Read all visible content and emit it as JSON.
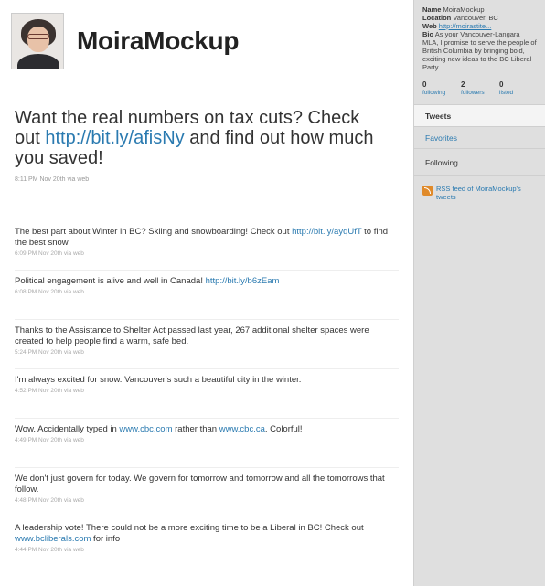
{
  "profile": {
    "screen_name": "MoiraMockup",
    "avatar_icon": "person-photo"
  },
  "featured_tweet": {
    "text_before": "Want the real numbers on tax cuts? Check out ",
    "link": "http://bit.ly/afisNy",
    "text_after": " and find out how much you saved!",
    "meta": "8:11 PM Nov 20th via web"
  },
  "tweets": [
    {
      "text": "The best part about Winter in BC? Skiing and snowboarding! Check out ",
      "link": "http://bit.ly/ayqUfT",
      "after": " to find the best snow.",
      "meta": "6:09 PM Nov 20th via web"
    },
    {
      "text": "Political engagement is alive and well in Canada! ",
      "link": "http://bit.ly/b6zEam",
      "after": "",
      "meta": "6:08 PM Nov 20th via web"
    },
    {
      "text": "Thanks to the Assistance to Shelter Act passed last year, 267 additional shelter spaces were created to help people find a warm, safe bed.",
      "link": "",
      "after": "",
      "meta": "5:24 PM Nov 20th via web"
    },
    {
      "text": "I'm always excited for snow. Vancouver's such a beautiful city in the winter.",
      "link": "",
      "after": "",
      "meta": "4:52 PM Nov 20th via web"
    },
    {
      "text": "Wow. Accidentally typed in ",
      "link": "www.cbc.com",
      "after": " rather than ",
      "link2": "www.cbc.ca",
      "after2": ". Colorful!",
      "meta": "4:49 PM Nov 20th via web"
    },
    {
      "text": "We don't just govern for today. We govern for tomorrow and tomorrow and all the tomorrows that follow.",
      "link": "",
      "after": "",
      "meta": "4:48 PM Nov 20th via web"
    },
    {
      "text": "A leadership vote! There could not be a more exciting time to be a Liberal in BC! Check out ",
      "link": "www.bcliberals.com",
      "after": " for info",
      "meta": "4:44 PM Nov 20th via web"
    }
  ],
  "sidebar": {
    "name_label": "Name",
    "name_value": "MoiraMockup",
    "location_label": "Location",
    "location_value": "Vancouver, BC",
    "web_label": "Web",
    "web_value": "http://moirastite...",
    "bio_label": "Bio",
    "bio_value": "As your Vancouver-Langara MLA, I promise to serve the people of British Columbia by bringing bold, exciting new ideas to the BC Liberal Party.",
    "stats": [
      {
        "count": "0",
        "label": "following"
      },
      {
        "count": "2",
        "label": "followers"
      },
      {
        "count": "0",
        "label": "listed"
      }
    ],
    "nav": {
      "tweets": "Tweets",
      "favorites": "Favorites",
      "following": "Following"
    },
    "rss_label": "RSS feed of MoiraMockup's tweets"
  },
  "colors": {
    "link": "#2a7ab0",
    "sidebar_bg": "#dfdfdf",
    "rss": "#e08a2a"
  }
}
